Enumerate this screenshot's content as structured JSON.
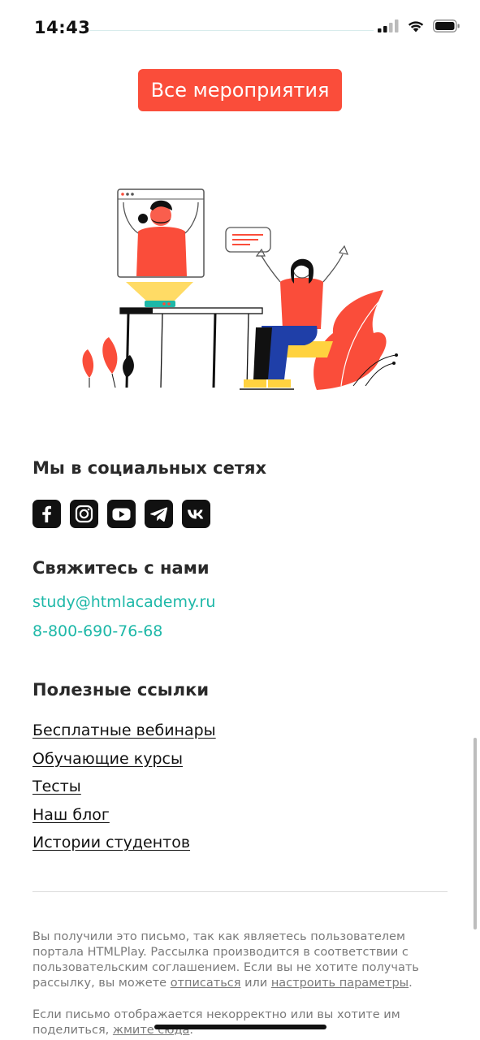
{
  "status_bar": {
    "time": "14:43",
    "icons": [
      "signal-icon",
      "wifi-icon",
      "battery-icon"
    ]
  },
  "cta": {
    "label": "Все мероприятия",
    "color": "#fa4d3a"
  },
  "illustration": {
    "name": "online-webinar-illustration",
    "accent": "#fa4d3a",
    "secondary": "#ffd23f",
    "pants": "#1f3fa8"
  },
  "social": {
    "title": "Мы в социальных сетях",
    "items": [
      {
        "name": "facebook-icon"
      },
      {
        "name": "instagram-icon"
      },
      {
        "name": "youtube-icon"
      },
      {
        "name": "telegram-icon"
      },
      {
        "name": "vk-icon"
      }
    ]
  },
  "contact": {
    "title": "Свяжитесь с нами",
    "email": "study@htmlacademy.ru",
    "phone": "8-800-690-76-68",
    "link_color": "#1eb8a8"
  },
  "useful": {
    "title": "Полезные ссылки",
    "links": [
      "Бесплатные вебинары",
      "Обучающие курсы",
      "Тесты",
      "Наш блог",
      "Истории студентов"
    ]
  },
  "footer": {
    "p1_a": "Вы получили это письмо, так как являетесь пользователем портала HTMLPlay. Рассылка производится в соответствии с пользовательским соглашением. Если вы не хотите получать рассылку, вы можете ",
    "unsubscribe": "отписаться",
    "p1_b": " или ",
    "settings": "настроить параметры",
    "p1_c": ".",
    "p2_a": "Если письмо отображается некорректно или вы хотите им поделиться, ",
    "click_here": "жмите сюда",
    "p2_b": "."
  }
}
